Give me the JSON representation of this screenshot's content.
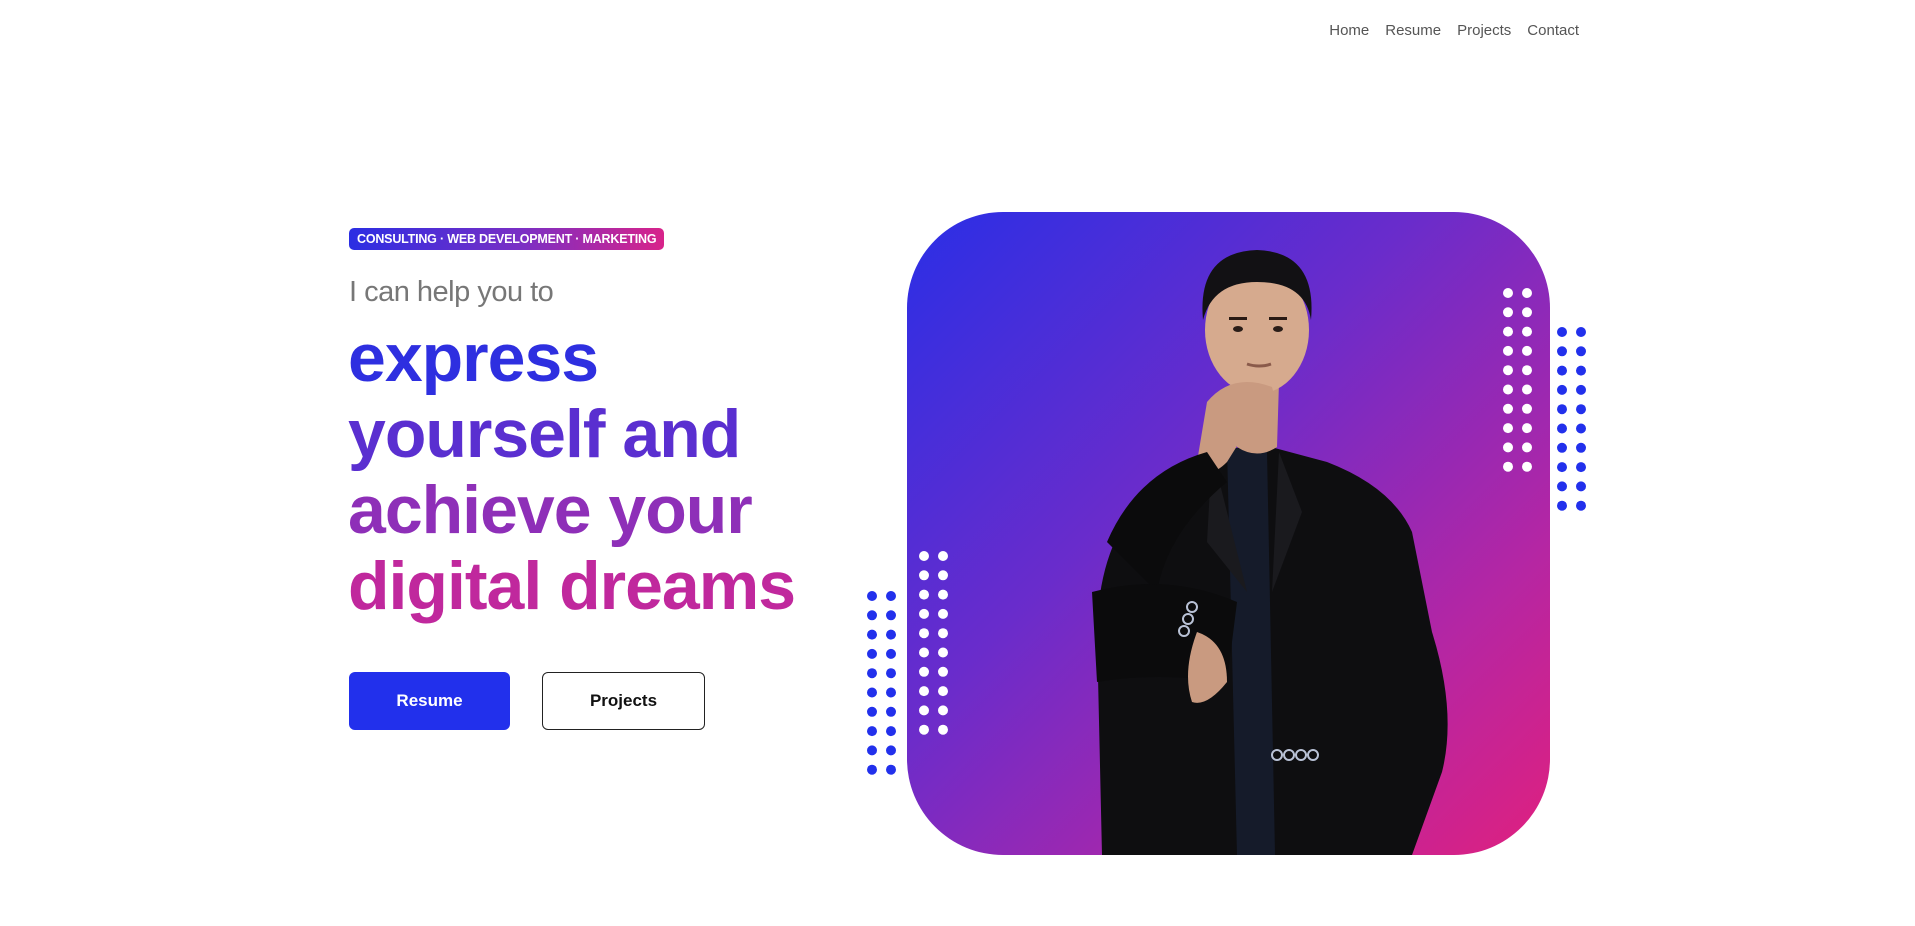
{
  "nav": {
    "items": [
      {
        "label": "Home"
      },
      {
        "label": "Resume"
      },
      {
        "label": "Projects"
      },
      {
        "label": "Contact"
      }
    ]
  },
  "hero": {
    "badge": "CONSULTING · WEB DEVELOPMENT · MARKETING",
    "intro": "I can help you to",
    "headline": [
      "express",
      "yourself and",
      "achieve your",
      "digital dreams"
    ],
    "buttons": {
      "primary": "Resume",
      "secondary": "Projects"
    }
  },
  "colors": {
    "accent_blue": "#2230ec",
    "accent_purple": "#7b2fc4",
    "accent_pink": "#e0207e",
    "dot_blue": "#2230ec",
    "dot_white": "#ffffff"
  }
}
